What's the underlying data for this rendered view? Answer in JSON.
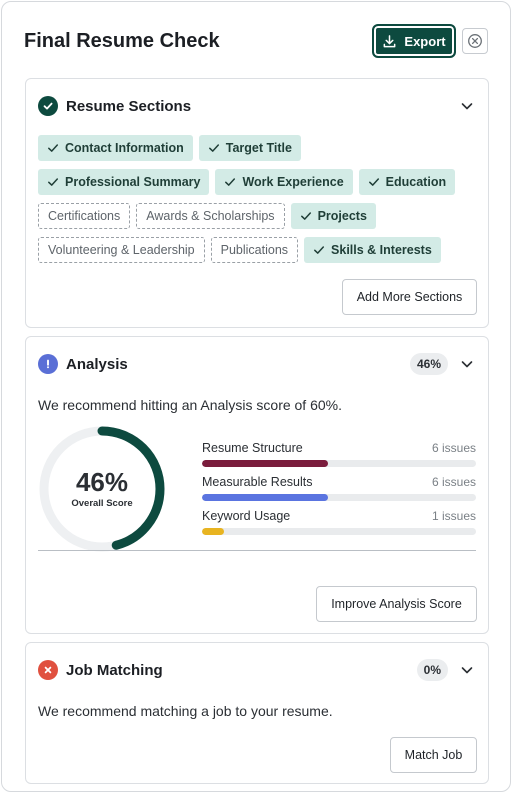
{
  "header": {
    "title": "Final Resume Check",
    "export_label": "Export",
    "export_icon": "download-icon",
    "close_icon": "close-circle-icon"
  },
  "colors": {
    "brand": "#0d4a3f",
    "chip_done_bg": "#d3ebe6",
    "analysis_status": "#5a6fd6",
    "job_status": "#e0503f",
    "structure_bar": "#7a1c3c",
    "measurable_bar": "#5a74e0",
    "keyword_bar": "#e8b421"
  },
  "resume_sections": {
    "title": "Resume Sections",
    "status_icon": "check-circle-icon",
    "rows": [
      [
        {
          "label": "Contact Information",
          "done": true
        },
        {
          "label": "Target Title",
          "done": true
        }
      ],
      [
        {
          "label": "Professional Summary",
          "done": true
        },
        {
          "label": "Work Experience",
          "done": true
        },
        {
          "label": "Education",
          "done": true
        }
      ],
      [
        {
          "label": "Certifications",
          "done": false
        },
        {
          "label": "Awards & Scholarships",
          "done": false
        },
        {
          "label": "Projects",
          "done": true
        }
      ],
      [
        {
          "label": "Volunteering & Leadership",
          "done": false
        },
        {
          "label": "Publications",
          "done": false
        },
        {
          "label": "Skills & Interests",
          "done": true
        }
      ]
    ],
    "add_button": "Add More Sections"
  },
  "analysis": {
    "title": "Analysis",
    "status_icon": "exclamation-circle-icon",
    "badge": "46%",
    "recommendation": "We recommend hitting an Analysis score of 60%.",
    "score": 46,
    "score_label": "46%",
    "score_caption": "Overall Score",
    "metrics": [
      {
        "name": "Resume Structure",
        "issues": "6 issues",
        "progress": 0.46
      },
      {
        "name": "Measurable Results",
        "issues": "6 issues",
        "progress": 0.46
      },
      {
        "name": "Keyword Usage",
        "issues": "1 issues",
        "progress": 0.08
      }
    ],
    "improve_button": "Improve Analysis Score"
  },
  "job_matching": {
    "title": "Job Matching",
    "status_icon": "x-circle-icon",
    "badge": "0%",
    "recommendation": "We recommend matching a job to your resume.",
    "match_button": "Match Job"
  }
}
